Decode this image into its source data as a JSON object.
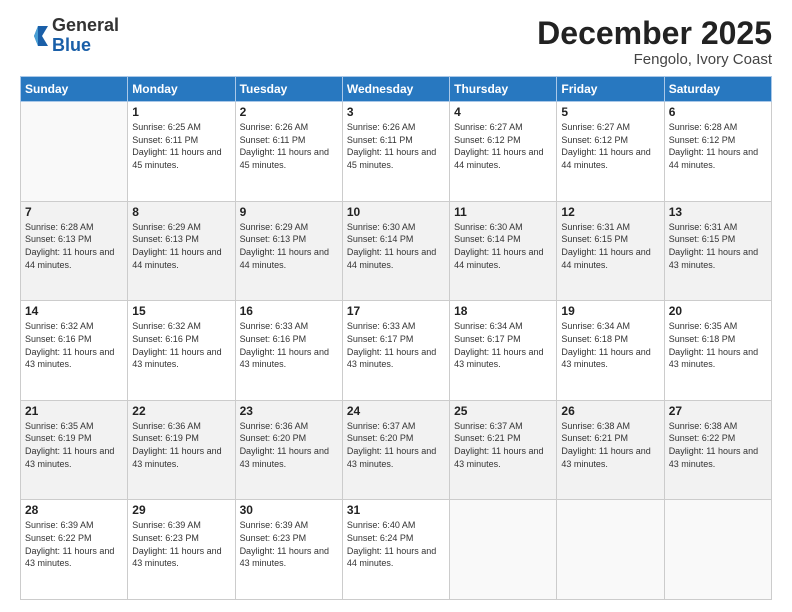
{
  "header": {
    "logo_general": "General",
    "logo_blue": "Blue",
    "month_year": "December 2025",
    "location": "Fengolo, Ivory Coast"
  },
  "days_of_week": [
    "Sunday",
    "Monday",
    "Tuesday",
    "Wednesday",
    "Thursday",
    "Friday",
    "Saturday"
  ],
  "weeks": [
    [
      {
        "day": "",
        "info": ""
      },
      {
        "day": "1",
        "info": "Sunrise: 6:25 AM\nSunset: 6:11 PM\nDaylight: 11 hours and 45 minutes."
      },
      {
        "day": "2",
        "info": "Sunrise: 6:26 AM\nSunset: 6:11 PM\nDaylight: 11 hours and 45 minutes."
      },
      {
        "day": "3",
        "info": "Sunrise: 6:26 AM\nSunset: 6:11 PM\nDaylight: 11 hours and 45 minutes."
      },
      {
        "day": "4",
        "info": "Sunrise: 6:27 AM\nSunset: 6:12 PM\nDaylight: 11 hours and 44 minutes."
      },
      {
        "day": "5",
        "info": "Sunrise: 6:27 AM\nSunset: 6:12 PM\nDaylight: 11 hours and 44 minutes."
      },
      {
        "day": "6",
        "info": "Sunrise: 6:28 AM\nSunset: 6:12 PM\nDaylight: 11 hours and 44 minutes."
      }
    ],
    [
      {
        "day": "7",
        "info": "Sunrise: 6:28 AM\nSunset: 6:13 PM\nDaylight: 11 hours and 44 minutes."
      },
      {
        "day": "8",
        "info": "Sunrise: 6:29 AM\nSunset: 6:13 PM\nDaylight: 11 hours and 44 minutes."
      },
      {
        "day": "9",
        "info": "Sunrise: 6:29 AM\nSunset: 6:13 PM\nDaylight: 11 hours and 44 minutes."
      },
      {
        "day": "10",
        "info": "Sunrise: 6:30 AM\nSunset: 6:14 PM\nDaylight: 11 hours and 44 minutes."
      },
      {
        "day": "11",
        "info": "Sunrise: 6:30 AM\nSunset: 6:14 PM\nDaylight: 11 hours and 44 minutes."
      },
      {
        "day": "12",
        "info": "Sunrise: 6:31 AM\nSunset: 6:15 PM\nDaylight: 11 hours and 44 minutes."
      },
      {
        "day": "13",
        "info": "Sunrise: 6:31 AM\nSunset: 6:15 PM\nDaylight: 11 hours and 43 minutes."
      }
    ],
    [
      {
        "day": "14",
        "info": "Sunrise: 6:32 AM\nSunset: 6:16 PM\nDaylight: 11 hours and 43 minutes."
      },
      {
        "day": "15",
        "info": "Sunrise: 6:32 AM\nSunset: 6:16 PM\nDaylight: 11 hours and 43 minutes."
      },
      {
        "day": "16",
        "info": "Sunrise: 6:33 AM\nSunset: 6:16 PM\nDaylight: 11 hours and 43 minutes."
      },
      {
        "day": "17",
        "info": "Sunrise: 6:33 AM\nSunset: 6:17 PM\nDaylight: 11 hours and 43 minutes."
      },
      {
        "day": "18",
        "info": "Sunrise: 6:34 AM\nSunset: 6:17 PM\nDaylight: 11 hours and 43 minutes."
      },
      {
        "day": "19",
        "info": "Sunrise: 6:34 AM\nSunset: 6:18 PM\nDaylight: 11 hours and 43 minutes."
      },
      {
        "day": "20",
        "info": "Sunrise: 6:35 AM\nSunset: 6:18 PM\nDaylight: 11 hours and 43 minutes."
      }
    ],
    [
      {
        "day": "21",
        "info": "Sunrise: 6:35 AM\nSunset: 6:19 PM\nDaylight: 11 hours and 43 minutes."
      },
      {
        "day": "22",
        "info": "Sunrise: 6:36 AM\nSunset: 6:19 PM\nDaylight: 11 hours and 43 minutes."
      },
      {
        "day": "23",
        "info": "Sunrise: 6:36 AM\nSunset: 6:20 PM\nDaylight: 11 hours and 43 minutes."
      },
      {
        "day": "24",
        "info": "Sunrise: 6:37 AM\nSunset: 6:20 PM\nDaylight: 11 hours and 43 minutes."
      },
      {
        "day": "25",
        "info": "Sunrise: 6:37 AM\nSunset: 6:21 PM\nDaylight: 11 hours and 43 minutes."
      },
      {
        "day": "26",
        "info": "Sunrise: 6:38 AM\nSunset: 6:21 PM\nDaylight: 11 hours and 43 minutes."
      },
      {
        "day": "27",
        "info": "Sunrise: 6:38 AM\nSunset: 6:22 PM\nDaylight: 11 hours and 43 minutes."
      }
    ],
    [
      {
        "day": "28",
        "info": "Sunrise: 6:39 AM\nSunset: 6:22 PM\nDaylight: 11 hours and 43 minutes."
      },
      {
        "day": "29",
        "info": "Sunrise: 6:39 AM\nSunset: 6:23 PM\nDaylight: 11 hours and 43 minutes."
      },
      {
        "day": "30",
        "info": "Sunrise: 6:39 AM\nSunset: 6:23 PM\nDaylight: 11 hours and 43 minutes."
      },
      {
        "day": "31",
        "info": "Sunrise: 6:40 AM\nSunset: 6:24 PM\nDaylight: 11 hours and 44 minutes."
      },
      {
        "day": "",
        "info": ""
      },
      {
        "day": "",
        "info": ""
      },
      {
        "day": "",
        "info": ""
      }
    ]
  ]
}
